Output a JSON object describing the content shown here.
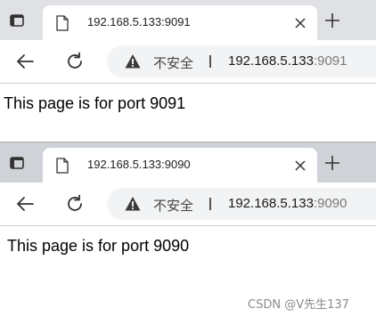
{
  "windows": [
    {
      "tab": {
        "title": "192.168.5.133:9091"
      },
      "address": {
        "security_label": "不安全",
        "divider": "|",
        "host": "192.168.5.133",
        "port": ":9091"
      },
      "page": {
        "text": "This page is for port 9091"
      }
    },
    {
      "tab": {
        "title": "192.168.5.133:9090"
      },
      "address": {
        "security_label": "不安全",
        "divider": "|",
        "host": "192.168.5.133",
        "port": ":9090"
      },
      "page": {
        "text": "This page is for port 9090"
      }
    }
  ],
  "icons": {
    "tab_actions": "tab-actions-icon",
    "favicon": "page-icon",
    "close": "close-icon",
    "new_tab": "plus-icon",
    "back": "back-arrow-icon",
    "reload": "reload-icon",
    "security": "warning-icon"
  },
  "colors": {
    "tabbar_active": "#dfe1e5",
    "tabbar_inactive": "#cfd2d6",
    "addressbar": "#f1f3f4",
    "port_text": "#7a7a7a"
  },
  "watermark": {
    "text": "CSDN @V先生137"
  }
}
